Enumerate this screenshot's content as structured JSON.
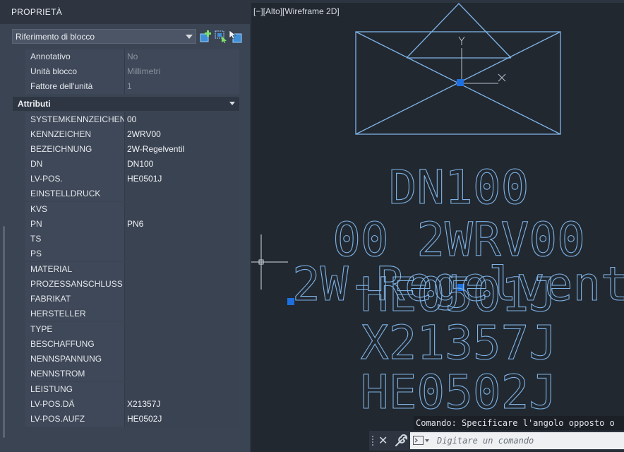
{
  "palette": {
    "title": "PROPRIETÀ",
    "selector_value": "Riferimento di blocco",
    "tool_icons": [
      "add-to-selection-icon",
      "quick-select-icon",
      "select-objects-icon"
    ],
    "general_rows": [
      {
        "name": "Annotativo",
        "value": "No"
      },
      {
        "name": "Unità blocco",
        "value": "Millimetri"
      },
      {
        "name": "Fattore dell'unità",
        "value": "1"
      }
    ],
    "attributes_header": "Attributi",
    "attributes": [
      {
        "name": "SYSTEMKENNZEICHEN",
        "value": "00"
      },
      {
        "name": "KENNZEICHEN",
        "value": "2WRV00"
      },
      {
        "name": "BEZEICHNUNG",
        "value": "2W-Regelventil"
      },
      {
        "name": "DN",
        "value": "DN100"
      },
      {
        "name": "LV-POS.",
        "value": "HE0501J"
      },
      {
        "name": "EINSTELLDRUCK",
        "value": ""
      },
      {
        "name": "KVS",
        "value": ""
      },
      {
        "name": "PN",
        "value": "PN6"
      },
      {
        "name": "TS",
        "value": ""
      },
      {
        "name": "PS",
        "value": ""
      },
      {
        "name": "MATERIAL",
        "value": ""
      },
      {
        "name": "PROZESSANSCHLUSS",
        "value": ""
      },
      {
        "name": "FABRIKAT",
        "value": ""
      },
      {
        "name": "HERSTELLER",
        "value": ""
      },
      {
        "name": "TYPE",
        "value": ""
      },
      {
        "name": "BESCHAFFUNG",
        "value": ""
      },
      {
        "name": "NENNSPANNUNG",
        "value": ""
      },
      {
        "name": "NENNSTROM",
        "value": ""
      },
      {
        "name": "LEISTUNG",
        "value": ""
      },
      {
        "name": "LV-POS.DÄ",
        "value": "X21357J"
      },
      {
        "name": "LV-POS.AUFZ",
        "value": "HE0502J"
      }
    ]
  },
  "viewport": {
    "label": "[−][Alto][Wireframe 2D]",
    "ucs_y": "Y",
    "ucs_x": "X",
    "drawing_text": {
      "dn": "DN100",
      "kennzeichen": "00 2WRV00",
      "bezeichnung": "2W-Regelventil",
      "lvpos": "HE0501J",
      "lvpos_da": "X21357J",
      "lvpos_aufz": "HE0502J"
    },
    "colors": {
      "geometry": "#7fb3e6",
      "grip": "#1e6fe0"
    }
  },
  "command": {
    "history": "Comando: Specificare l'angolo opposto o",
    "placeholder": "Digitare un comando"
  }
}
